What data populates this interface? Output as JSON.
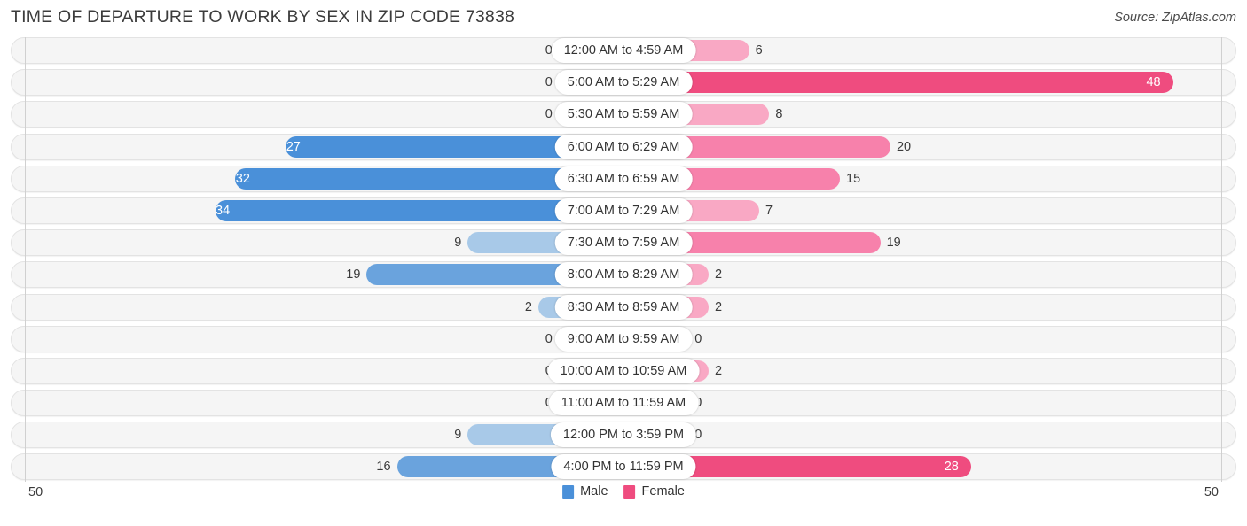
{
  "header": {
    "title": "TIME OF DEPARTURE TO WORK BY SEX IN ZIP CODE 73838",
    "source": "Source: ZipAtlas.com"
  },
  "legend": {
    "male_label": "Male",
    "female_label": "Female",
    "male_color": "#4a90d9",
    "female_color": "#ef4c7f"
  },
  "axis": {
    "left_max": "50",
    "right_max": "50",
    "max_value": 50
  },
  "colors": {
    "male_light": "#a8c9e8",
    "male_strong": "#6aa3dd",
    "male_deep": "#4a90d9",
    "female_light": "#f9a8c4",
    "female_strong": "#f781ab",
    "female_deep": "#ef4c7f",
    "track_bg": "#f5f5f5",
    "track_border": "#e3e3e3"
  },
  "chart_data": {
    "type": "bar",
    "title": "TIME OF DEPARTURE TO WORK BY SEX IN ZIP CODE 73838",
    "orientation": "horizontal-diverging",
    "xlabel": "",
    "ylabel": "",
    "xlim": [
      50,
      50
    ],
    "grid": false,
    "legend_position": "bottom-center",
    "categories": [
      "12:00 AM to 4:59 AM",
      "5:00 AM to 5:29 AM",
      "5:30 AM to 5:59 AM",
      "6:00 AM to 6:29 AM",
      "6:30 AM to 6:59 AM",
      "7:00 AM to 7:29 AM",
      "7:30 AM to 7:59 AM",
      "8:00 AM to 8:29 AM",
      "8:30 AM to 8:59 AM",
      "9:00 AM to 9:59 AM",
      "10:00 AM to 10:59 AM",
      "11:00 AM to 11:59 AM",
      "12:00 PM to 3:59 PM",
      "4:00 PM to 11:59 PM"
    ],
    "series": [
      {
        "name": "Male",
        "values": [
          0,
          0,
          0,
          27,
          32,
          34,
          9,
          19,
          2,
          0,
          0,
          0,
          9,
          16
        ]
      },
      {
        "name": "Female",
        "values": [
          6,
          48,
          8,
          20,
          15,
          7,
          19,
          2,
          2,
          0,
          2,
          0,
          0,
          28
        ]
      }
    ]
  }
}
